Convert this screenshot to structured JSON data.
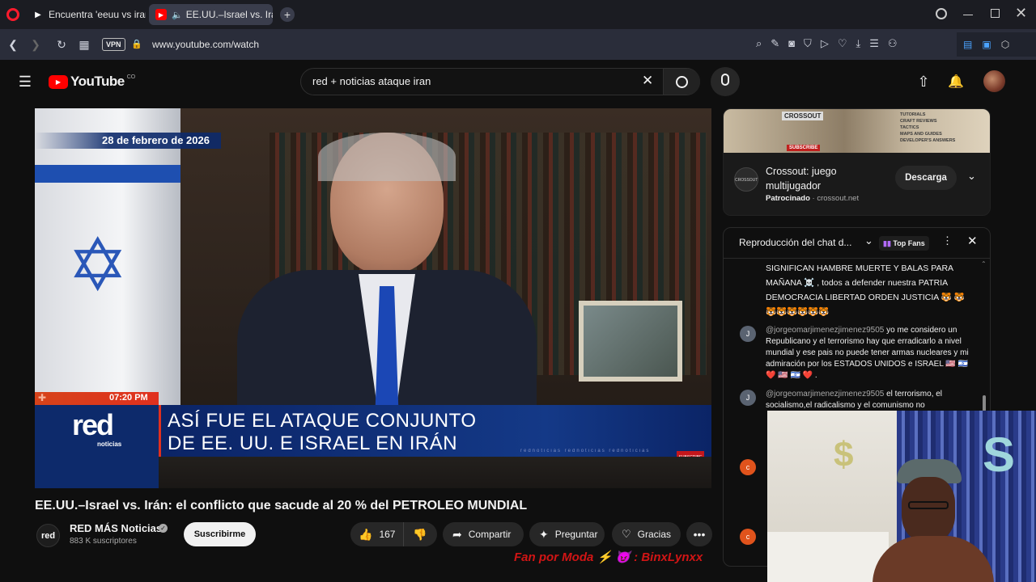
{
  "browser": {
    "tabs": [
      {
        "label": "Encuentra 'eeuu vs iran' en",
        "active": false
      },
      {
        "label": "EE.UU.–Israel vs. Irán: el",
        "active": true
      }
    ],
    "vpn_label": "VPN",
    "url": "www.youtube.com/watch"
  },
  "youtube": {
    "logo_text": "YouTube",
    "country_code": "CO",
    "search_value": "red + noticias ataque iran"
  },
  "video": {
    "date_overlay": "28 de febrero de 2026",
    "time_overlay": "07:20 PM",
    "channel_logo_text": "red",
    "channel_logo_sub": "noticias",
    "headline_line1": "ASÍ FUE EL ATAQUE CONJUNTO",
    "headline_line2": "DE EE. UU. E ISRAEL EN IRÁN",
    "ticker_text": "rednoticias   rednoticias   rednoticias",
    "subscribe_mini": "SUBSCRIBE",
    "title": "EE.UU.–Israel vs. Irán: el conflicto que sacude al 20 % del PETROLEO MUNDIAL"
  },
  "channel": {
    "name": "RED MÁS Noticias",
    "subscribers": "883 K suscriptores",
    "subscribe_label": "Suscribirme",
    "avatar_text": "red"
  },
  "actions": {
    "likes": "167",
    "share": "Compartir",
    "ask": "Preguntar",
    "thanks": "Gracias"
  },
  "ad": {
    "banner_brand": "CROSSOUT",
    "banner_lines": [
      "TUTORIALS",
      "CRAFT REVIEWS",
      "TACTICS",
      "MAPS AND GUIDES",
      "DEVELOPER'S ANSWERS"
    ],
    "banner_cta": "SUBSCRIBE",
    "title_line1": "Crossout: juego",
    "title_line2": "multijugador",
    "sponsored": "Patrocinado",
    "domain": "crossout.net",
    "button": "Descarga"
  },
  "chat": {
    "header": "Reproducción del chat d...",
    "filter": "Top Fans",
    "messages": [
      {
        "author": "",
        "text": "SIGNIFICAN HAMBRE MUERTE Y BALAS PARA MAÑANA ☠️ , todos a defender nuestra PATRIA DEMOCRACIA LIBERTAD ORDEN JUSTICIA 🐯 🐯🐯🐯🐯🐯🐯🐯"
      },
      {
        "author": "@jorgeomarjimenezjimenez9505",
        "text": "yo me considero un Republicano y el terrorismo hay que erradicarlo a nivel mundial y ese pais no puede tener armas nucleares y mi admiración por los ESTADOS UNIDOS e ISRAEL 🇺🇸 🇮🇱 ❤️ 🇺🇸 🇮🇱 ❤️ .",
        "avatar": "J"
      },
      {
        "author": "@jorgeomarjimenezjimenez9505",
        "text": "el terrorismo, el socialismo,el radicalismo y el comunismo no",
        "avatar": "J"
      }
    ],
    "extra_avatars": [
      "c",
      "c"
    ]
  },
  "overlay": {
    "text": "Fan por Moda ⚡ 😈 : BinxLynxx"
  },
  "colors": {
    "yt_red": "#ff0000",
    "bg": "#0f0f0f",
    "browser_bar": "#2a2d3a",
    "overlay_red": "#d11515",
    "news_red": "#e0301e",
    "news_blue": "#0d2a6b"
  }
}
